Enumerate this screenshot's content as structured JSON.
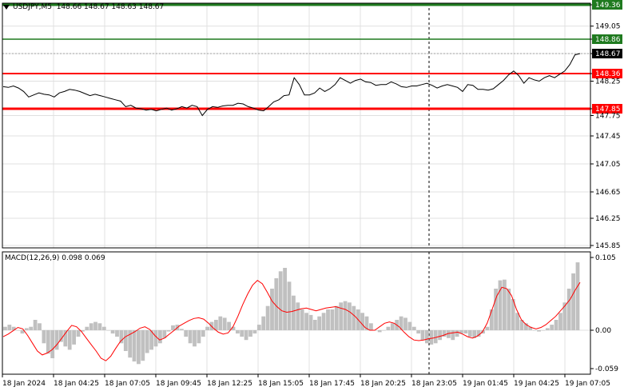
{
  "header": {
    "symbol": "USDJPY,M5",
    "ohlc": "148.66 148.67 148.63 148.67"
  },
  "macd_header": {
    "label": "MACD(12,26,9)",
    "values": "0.098 0.069"
  },
  "colors": {
    "price_line": "#000000",
    "resistance_green": "#1f7a1f",
    "support_red": "#ff0000",
    "macd_hist": "#c0c0c0",
    "signal_line": "#ff0000",
    "grid": "#e0e0e0"
  },
  "chart_data": [
    {
      "type": "line",
      "title": "USDJPY,M5",
      "ylim": [
        145.85,
        149.36
      ],
      "y_ticks": [
        "149.36",
        "149.05",
        "148.86",
        "148.67",
        "148.36",
        "148.25",
        "147.85",
        "147.75",
        "147.45",
        "147.05",
        "146.65",
        "146.25",
        "145.85"
      ],
      "x_ticks": [
        "18 Jan 2024",
        "18 Jan 04:25",
        "18 Jan 07:05",
        "18 Jan 09:45",
        "18 Jan 12:25",
        "18 Jan 15:05",
        "18 Jan 17:45",
        "18 Jan 20:25",
        "18 Jan 23:05",
        "19 Jan 01:45",
        "19 Jan 04:25",
        "19 Jan 07:05"
      ],
      "horizontal_levels": [
        {
          "value": 149.36,
          "label": "149.36",
          "color": "green"
        },
        {
          "value": 148.86,
          "label": "148.86",
          "color": "green"
        },
        {
          "value": 148.36,
          "label": "148.36",
          "color": "red"
        },
        {
          "value": 147.85,
          "label": "147.85",
          "color": "red"
        }
      ],
      "current_price": {
        "value": 148.67,
        "label": "148.67"
      },
      "vertical_marker": "18 Jan 23:05",
      "series": [
        {
          "values": [
            148.17,
            148.16,
            148.18,
            148.15,
            148.1,
            148.02,
            148.05,
            148.08,
            148.06,
            148.05,
            148.02,
            148.08,
            148.1,
            148.13,
            148.12,
            148.1,
            148.07,
            148.04,
            148.06,
            148.04,
            148.02,
            148.0,
            147.98,
            147.96,
            147.88,
            147.9,
            147.86,
            147.85,
            147.83,
            147.84,
            147.82,
            147.84,
            147.86,
            147.83,
            147.85,
            147.88,
            147.86,
            147.9,
            147.88,
            147.75,
            147.84,
            147.88,
            147.87,
            147.89,
            147.9,
            147.9,
            147.93,
            147.92,
            147.88,
            147.86,
            147.83,
            147.82,
            147.88,
            147.95,
            147.98,
            148.04,
            148.05,
            148.3,
            148.2,
            148.05,
            148.05,
            148.08,
            148.15,
            148.1,
            148.14,
            148.2,
            148.3,
            148.26,
            148.22,
            148.26,
            148.28,
            148.24,
            148.23,
            148.19,
            148.2,
            148.2,
            148.24,
            148.21,
            148.17,
            148.16,
            148.18,
            148.18,
            148.2,
            148.22,
            148.19,
            148.15,
            148.18,
            148.2,
            148.18,
            148.16,
            148.1,
            148.2,
            148.19,
            148.13,
            148.13,
            148.12,
            148.14,
            148.2,
            148.26,
            148.34,
            148.4,
            148.33,
            148.22,
            148.3,
            148.27,
            148.25,
            148.3,
            148.33,
            148.3,
            148.35,
            148.4,
            148.5,
            148.65,
            148.67
          ]
        }
      ]
    },
    {
      "type": "bar",
      "title": "MACD(12,26,9)",
      "ylim": [
        -0.059,
        0.105
      ],
      "y_ticks": [
        "0.105",
        "0.00",
        "-0.059"
      ],
      "series": [
        {
          "name": "MACD(12,26,9)",
          "kind": "histogram",
          "values": [
            0.005,
            0.008,
            0.005,
            0.0,
            -0.005,
            0.003,
            0.005,
            0.015,
            0.01,
            -0.02,
            -0.036,
            -0.043,
            -0.03,
            -0.018,
            -0.025,
            -0.03,
            -0.022,
            -0.01,
            -0.002,
            0.005,
            0.01,
            0.012,
            0.01,
            0.005,
            0.0,
            -0.005,
            -0.01,
            -0.02,
            -0.032,
            -0.042,
            -0.048,
            -0.052,
            -0.047,
            -0.035,
            -0.03,
            -0.025,
            -0.02,
            -0.012,
            -0.002,
            0.007,
            0.008,
            0.002,
            -0.01,
            -0.02,
            -0.025,
            -0.02,
            -0.01,
            0.005,
            0.012,
            0.015,
            0.02,
            0.018,
            0.012,
            0.005,
            -0.005,
            -0.01,
            -0.015,
            -0.01,
            -0.005,
            0.008,
            0.02,
            0.035,
            0.06,
            0.075,
            0.085,
            0.09,
            0.07,
            0.05,
            0.04,
            0.03,
            0.025,
            0.022,
            0.015,
            0.02,
            0.025,
            0.03,
            0.03,
            0.035,
            0.04,
            0.042,
            0.04,
            0.035,
            0.03,
            0.025,
            0.02,
            0.01,
            0.0,
            -0.003,
            0.0,
            0.005,
            0.01,
            0.015,
            0.02,
            0.018,
            0.012,
            0.005,
            -0.005,
            -0.015,
            -0.02,
            -0.022,
            -0.02,
            -0.015,
            -0.01,
            -0.012,
            -0.015,
            -0.01,
            -0.005,
            -0.005,
            -0.01,
            -0.012,
            -0.01,
            -0.005,
            0.005,
            0.03,
            0.06,
            0.072,
            0.073,
            0.06,
            0.045,
            0.025,
            0.015,
            0.01,
            0.005,
            0.0,
            -0.002,
            0.0,
            0.003,
            0.008,
            0.015,
            0.025,
            0.04,
            0.06,
            0.082,
            0.098
          ]
        },
        {
          "name": "signal",
          "kind": "line",
          "values": [
            -0.01,
            -0.006,
            -0.001,
            0.004,
            0.002,
            -0.008,
            -0.02,
            -0.032,
            -0.038,
            -0.035,
            -0.03,
            -0.022,
            -0.012,
            -0.002,
            0.007,
            0.005,
            -0.002,
            -0.012,
            -0.022,
            -0.032,
            -0.043,
            -0.047,
            -0.04,
            -0.028,
            -0.017,
            -0.01,
            -0.006,
            -0.002,
            0.003,
            0.005,
            0.001,
            -0.008,
            -0.015,
            -0.012,
            -0.006,
            0.0,
            0.006,
            0.01,
            0.014,
            0.017,
            0.018,
            0.016,
            0.01,
            0.003,
            -0.003,
            -0.006,
            -0.004,
            0.005,
            0.02,
            0.037,
            0.052,
            0.065,
            0.072,
            0.067,
            0.055,
            0.042,
            0.034,
            0.028,
            0.026,
            0.027,
            0.029,
            0.031,
            0.032,
            0.03,
            0.028,
            0.03,
            0.032,
            0.033,
            0.034,
            0.032,
            0.03,
            0.026,
            0.02,
            0.012,
            0.004,
            0.0,
            0.0,
            0.005,
            0.01,
            0.012,
            0.01,
            0.005,
            -0.003,
            -0.01,
            -0.015,
            -0.016,
            -0.015,
            -0.013,
            -0.012,
            -0.01,
            -0.008,
            -0.005,
            -0.004,
            -0.003,
            -0.006,
            -0.01,
            -0.012,
            -0.009,
            -0.003,
            0.01,
            0.03,
            0.05,
            0.062,
            0.06,
            0.05,
            0.03,
            0.015,
            0.008,
            0.004,
            0.002,
            0.004,
            0.008,
            0.014,
            0.02,
            0.028,
            0.036,
            0.045,
            0.058,
            0.069
          ]
        }
      ]
    }
  ]
}
